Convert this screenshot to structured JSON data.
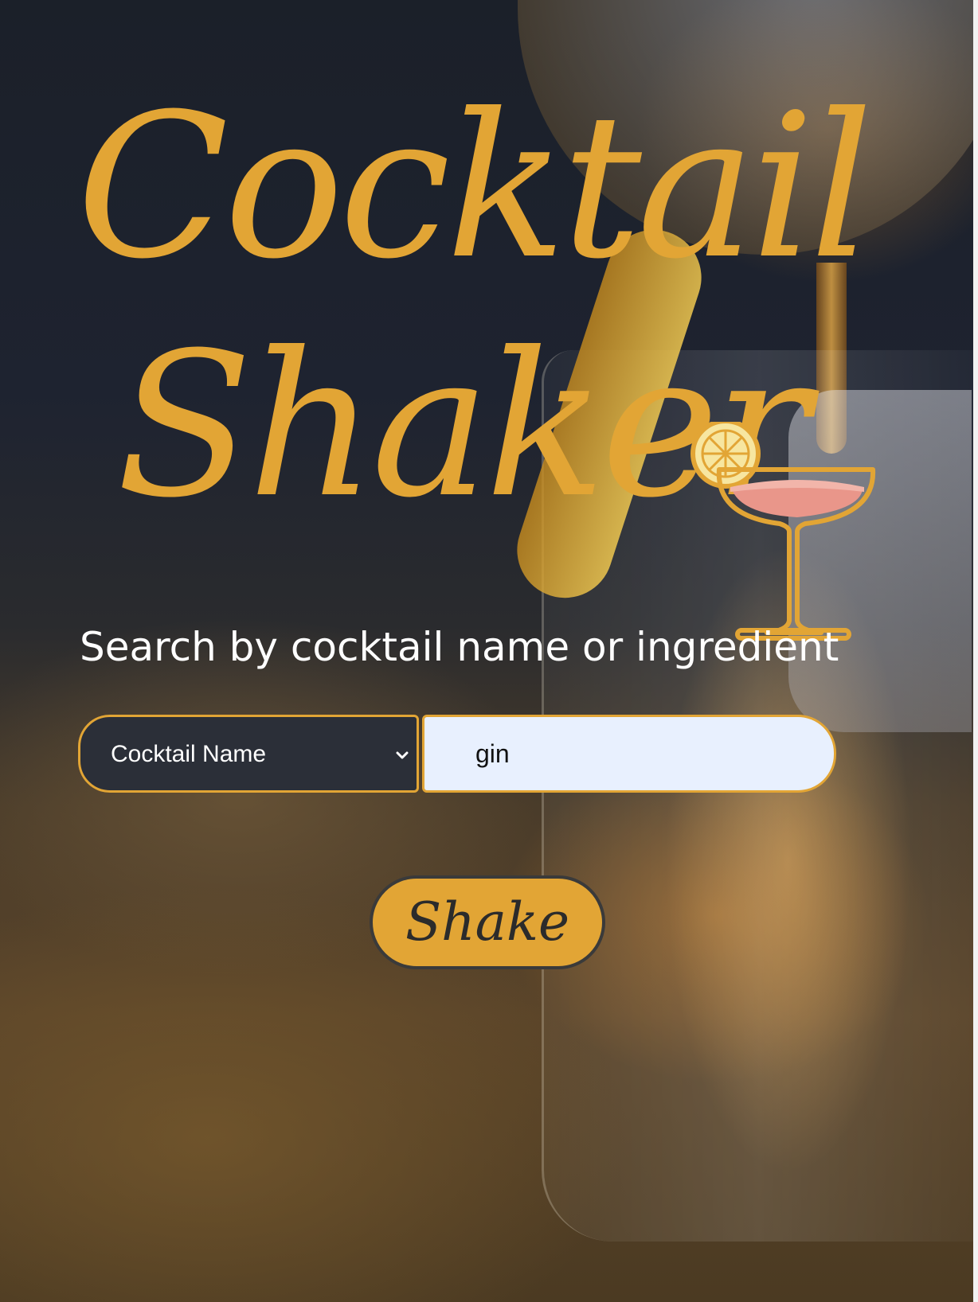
{
  "logo": {
    "line1": "Cocktail",
    "line2": "Shaker",
    "icon": "cocktail-glass-with-lemon-icon"
  },
  "search": {
    "label": "Search by cocktail name or ingredient",
    "type_select": {
      "selected": "Cocktail Name",
      "icon": "chevron-down-icon"
    },
    "query": {
      "value": "gin"
    },
    "submit_label": "Shake"
  },
  "colors": {
    "accent": "#e2a535",
    "select_bg": "#2b2f38",
    "input_bg": "#e8f0fe",
    "drink_pink": "#e9968a",
    "lemon": "#f7e6a0"
  }
}
